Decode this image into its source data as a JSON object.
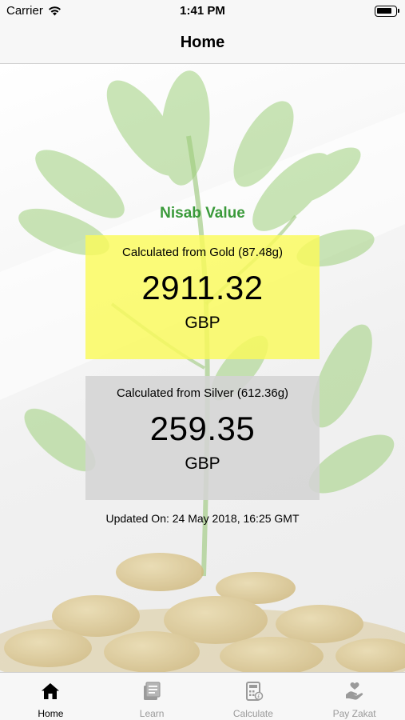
{
  "status_bar": {
    "carrier": "Carrier",
    "time": "1:41 PM"
  },
  "nav": {
    "title": "Home"
  },
  "nisab": {
    "title": "Nisab Value",
    "gold": {
      "label": "Calculated from Gold (87.48g)",
      "value": "2911.32",
      "currency": "GBP",
      "color": "#FAFA5A"
    },
    "silver": {
      "label": "Calculated from Silver (612.36g)",
      "value": "259.35",
      "currency": "GBP",
      "color": "#D4D4D4"
    },
    "updated": "Updated On: 24 May 2018, 16:25 GMT",
    "title_color": "#3A9A3A"
  },
  "tabs": [
    {
      "label": "Home",
      "icon": "home-icon",
      "active": true
    },
    {
      "label": "Learn",
      "icon": "book-icon",
      "active": false
    },
    {
      "label": "Calculate",
      "icon": "calculator-icon",
      "active": false
    },
    {
      "label": "Pay Zakat",
      "icon": "hand-heart-icon",
      "active": false
    }
  ]
}
